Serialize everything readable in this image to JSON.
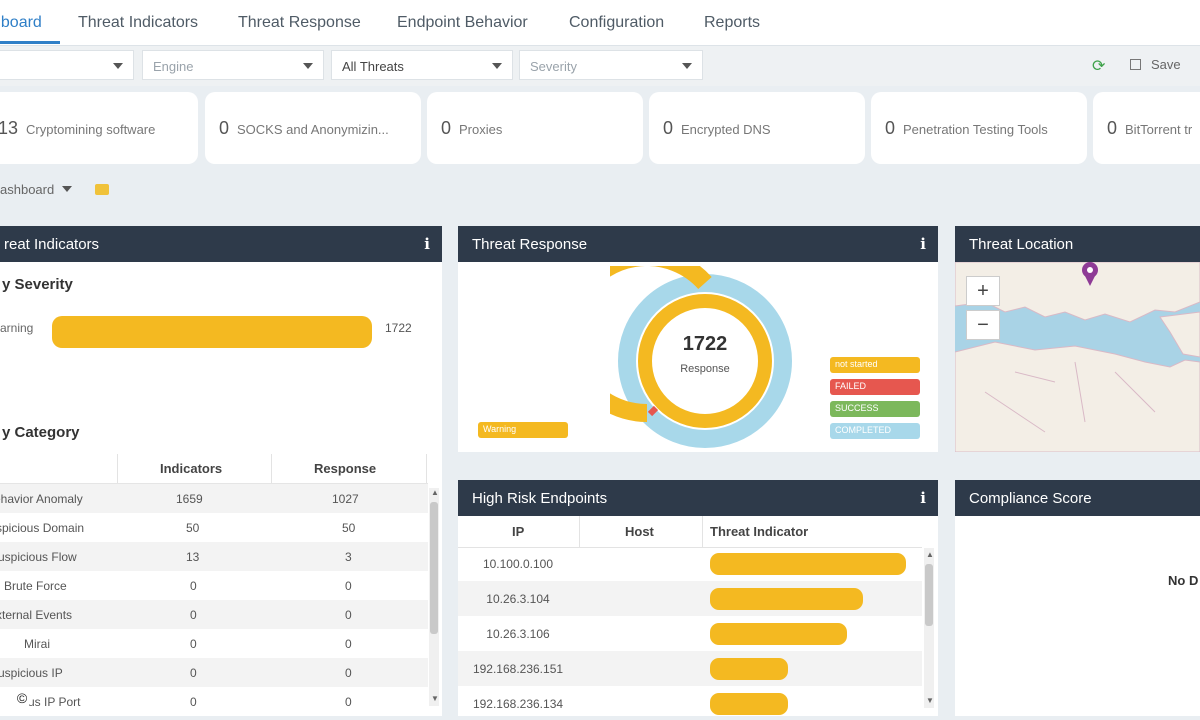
{
  "nav": {
    "tabs": [
      {
        "label": "hboard",
        "active": true
      },
      {
        "label": "Threat Indicators"
      },
      {
        "label": "Threat Response"
      },
      {
        "label": "Endpoint Behavior"
      },
      {
        "label": "Configuration"
      },
      {
        "label": "Reports"
      }
    ]
  },
  "filters": {
    "engine_placeholder": "Engine",
    "threats_value": "All Threats",
    "severity_placeholder": "Severity",
    "save_label": "Save"
  },
  "stat_cards": [
    {
      "count": "13",
      "label": "Cryptomining software"
    },
    {
      "count": "0",
      "label": "SOCKS and Anonymizin..."
    },
    {
      "count": "0",
      "label": "Proxies"
    },
    {
      "count": "0",
      "label": "Encrypted DNS"
    },
    {
      "count": "0",
      "label": "Penetration Testing Tools"
    },
    {
      "count": "0",
      "label": "BitTorrent tr"
    }
  ],
  "dashboard_selector": {
    "label": "ashboard"
  },
  "threat_indicators": {
    "title": "reat Indicators",
    "by_severity_heading": "y Severity",
    "severity": {
      "label": "arning",
      "value": "1722",
      "fraction": 1.0
    },
    "by_category_heading": "y Category",
    "columns": [
      "Indicators",
      "Response"
    ],
    "rows": [
      {
        "category": "ehavior Anomaly",
        "indicators": "1659",
        "response": "1027"
      },
      {
        "category": "spicious Domain",
        "indicators": "50",
        "response": "50"
      },
      {
        "category": "uspicious Flow",
        "indicators": "13",
        "response": "3"
      },
      {
        "category": "Brute Force",
        "indicators": "0",
        "response": "0"
      },
      {
        "category": "xternal Events",
        "indicators": "0",
        "response": "0"
      },
      {
        "category": "Mirai",
        "indicators": "0",
        "response": "0"
      },
      {
        "category": "uspicious IP",
        "indicators": "0",
        "response": "0"
      },
      {
        "category": "us IP Port",
        "indicators": "0",
        "response": "0"
      }
    ]
  },
  "threat_response": {
    "title": "Threat Response",
    "total": "1722",
    "center_label": "Response",
    "warning_label": "Warning",
    "legend": [
      {
        "label": "not started",
        "color": "#f4b921"
      },
      {
        "label": "FAILED",
        "color": "#e6574f"
      },
      {
        "label": "SUCCESS",
        "color": "#7cb85c"
      },
      {
        "label": "COMPLETED",
        "color": "#a8d8ea"
      }
    ]
  },
  "threat_location": {
    "title": "Threat Location",
    "zoom_in": "+",
    "zoom_out": "−"
  },
  "high_risk_endpoints": {
    "title": "High Risk Endpoints",
    "columns": [
      "IP",
      "Host",
      "Threat Indicator"
    ],
    "rows": [
      {
        "ip": "10.100.0.100",
        "host": "",
        "level": 1.0
      },
      {
        "ip": "10.26.3.104",
        "host": "",
        "level": 0.78
      },
      {
        "ip": "10.26.3.106",
        "host": "",
        "level": 0.7
      },
      {
        "ip": "192.168.236.151",
        "host": "",
        "level": 0.4
      },
      {
        "ip": "192.168.236.134",
        "host": "",
        "level": 0.4
      }
    ]
  },
  "compliance_score": {
    "title": "Compliance Score",
    "empty_text": "No D"
  },
  "copyright_symbol": "©"
}
